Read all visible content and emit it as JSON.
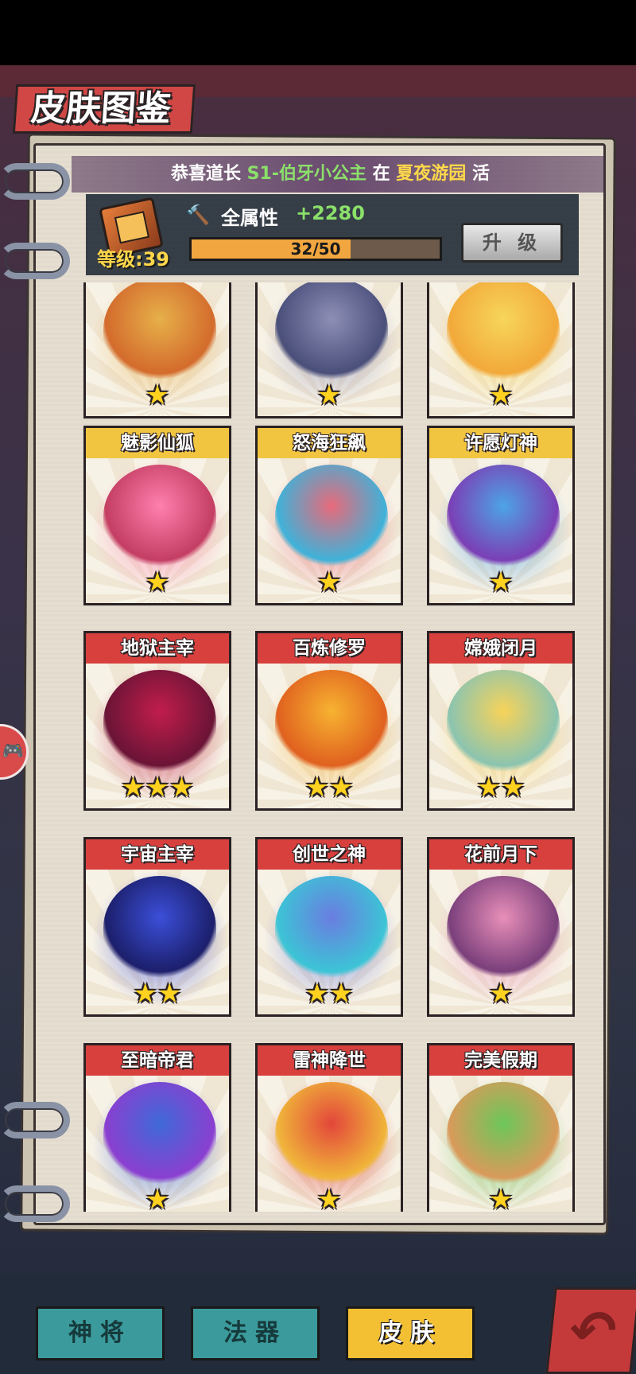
{
  "header": {
    "title": "皮肤图鉴"
  },
  "announcement": {
    "prefix": "恭喜道长 ",
    "skin": "S1-伯牙小公主",
    "mid": " 在 ",
    "place": "夏夜游园",
    "tail": " 活"
  },
  "level_panel": {
    "level_label": "等级:39",
    "attr_label": "全属性",
    "attr_value": "+2280",
    "progress_text": "32/50",
    "progress_current": 32,
    "progress_max": 50,
    "upgrade_label": "升 级"
  },
  "skins": [
    {
      "name": "",
      "stars": "★",
      "style": "none",
      "colors": [
        "#e7b04a",
        "#d36b2c"
      ]
    },
    {
      "name": "",
      "stars": "★",
      "style": "none",
      "colors": [
        "#8d8fb6",
        "#4a4f7a"
      ]
    },
    {
      "name": "",
      "stars": "★",
      "style": "none",
      "colors": [
        "#f7d65a",
        "#f2a93a"
      ]
    },
    {
      "name": "魅影仙狐",
      "stars": "★",
      "style": "gold",
      "colors": [
        "#ff7fae",
        "#c43e63"
      ]
    },
    {
      "name": "怒海狂飙",
      "stars": "★",
      "style": "gold",
      "colors": [
        "#e86a7a",
        "#3fb2d9"
      ]
    },
    {
      "name": "许愿灯神",
      "stars": "★",
      "style": "gold",
      "colors": [
        "#4da4e6",
        "#7b3fb5"
      ]
    },
    {
      "name": "地狱主宰",
      "stars": "★★★",
      "style": "red",
      "colors": [
        "#c21d4c",
        "#6a1436"
      ]
    },
    {
      "name": "百炼修罗",
      "stars": "★★",
      "style": "red",
      "colors": [
        "#f7b331",
        "#e0611f"
      ]
    },
    {
      "name": "嫦娥闭月",
      "stars": "★★",
      "style": "red",
      "colors": [
        "#f7d35a",
        "#8bc4b0"
      ]
    },
    {
      "name": "宇宙主宰",
      "stars": "★★",
      "style": "red",
      "colors": [
        "#3b4fd9",
        "#1c1f6b"
      ]
    },
    {
      "name": "创世之神",
      "stars": "★★",
      "style": "red",
      "colors": [
        "#6a7de0",
        "#3cc4d6"
      ]
    },
    {
      "name": "花前月下",
      "stars": "★",
      "style": "red",
      "colors": [
        "#e88fb9",
        "#7a3f7b"
      ]
    },
    {
      "name": "至暗帝君",
      "stars": "★",
      "style": "red",
      "colors": [
        "#3f6ad9",
        "#8a3fd0"
      ]
    },
    {
      "name": "雷神降世",
      "stars": "★",
      "style": "red",
      "colors": [
        "#e3463a",
        "#f0b53a"
      ]
    },
    {
      "name": "完美假期",
      "stars": "★",
      "style": "red",
      "colors": [
        "#6cc75a",
        "#d99a5a"
      ]
    }
  ],
  "tabs": [
    {
      "label": "神将",
      "active": false
    },
    {
      "label": "法器",
      "active": false
    },
    {
      "label": "皮肤",
      "active": true
    }
  ],
  "side_button_icon": "gamepad-icon",
  "back_button_icon": "return-arrow-icon"
}
